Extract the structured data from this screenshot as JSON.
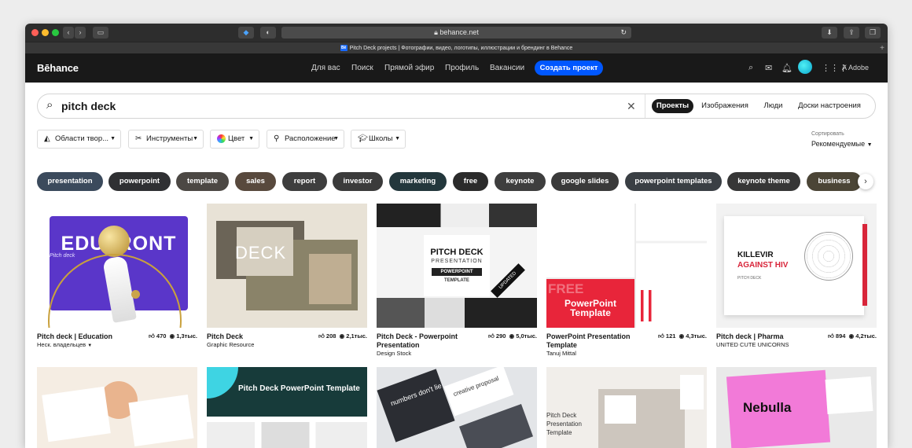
{
  "browser": {
    "url": "behance.net",
    "tab_title": "Pitch Deck projects | Фотографии, видео, логотипы, иллюстрации и брендинг в Behance",
    "favicon": "Bē"
  },
  "nav": {
    "logo": "Bēhance",
    "links": [
      "Для вас",
      "Поиск",
      "Прямой эфир",
      "Профиль",
      "Вакансии"
    ],
    "create_button": "Создать проект",
    "adobe": "Adobe"
  },
  "search": {
    "query": "pitch deck",
    "tabs": [
      "Проекты",
      "Изображения",
      "Люди",
      "Доски настроения"
    ]
  },
  "filters": {
    "items": [
      "Области твор...",
      "Инструменты",
      "Цвет",
      "Расположение",
      "Школы"
    ],
    "sort_label": "Сортировать",
    "sort_value": "Рекомендуемые"
  },
  "chips": [
    "presentation",
    "powerpoint",
    "template",
    "sales",
    "report",
    "investor",
    "marketing",
    "free",
    "keynote",
    "google slides",
    "powerpoint templates",
    "keynote theme",
    "business"
  ],
  "cards": [
    {
      "title": "Pitch deck | Education",
      "owner": "Неск. владельцев",
      "likes": "470",
      "views": "1,3тыс.",
      "thumb_text": "EDUFRONT",
      "thumb_sub": "Pitch deck"
    },
    {
      "title": "Pitch Deck",
      "owner": "Graphic Resource",
      "likes": "208",
      "views": "2,1тыс.",
      "thumb_text": "DECK"
    },
    {
      "title": "Pitch Deck - Powerpoint Presentation",
      "owner": "Design Stock",
      "likes": "290",
      "views": "5,0тыс.",
      "thumb_text": "PITCH DECK",
      "thumb_sub": "PRESENTATION",
      "thumb_band": "POWERPOINT",
      "thumb_sub2": "TEMPLATE",
      "thumb_badge": "UPDATED"
    },
    {
      "title": "PowerPoint Presentation Template",
      "owner": "Tanuj Mittal",
      "likes": "121",
      "views": "4,3тыс.",
      "thumb_text": "PowerPoint",
      "thumb_sub": "Template",
      "thumb_free": "FREE"
    },
    {
      "title": "Pitch deck | Pharma",
      "owner": "UNITED CUTE UNICORNS",
      "likes": "894",
      "views": "4,2тыс.",
      "thumb_text": "KILLEVIR",
      "thumb_sub": "AGAINST HIV",
      "thumb_sub2": "PITCH DECK"
    }
  ],
  "row2": [
    {
      "thumb_text": ""
    },
    {
      "thumb_text": "Pitch Deck PowerPoint Template"
    },
    {
      "thumb_text": "numbers don't lie",
      "thumb_sub": "creative proposal"
    },
    {
      "thumb_text": "Pitch Deck Presentation Template"
    },
    {
      "thumb_text": "Nebulla"
    }
  ],
  "colors": {
    "accent": "#0057ff",
    "dark": "#191919"
  }
}
